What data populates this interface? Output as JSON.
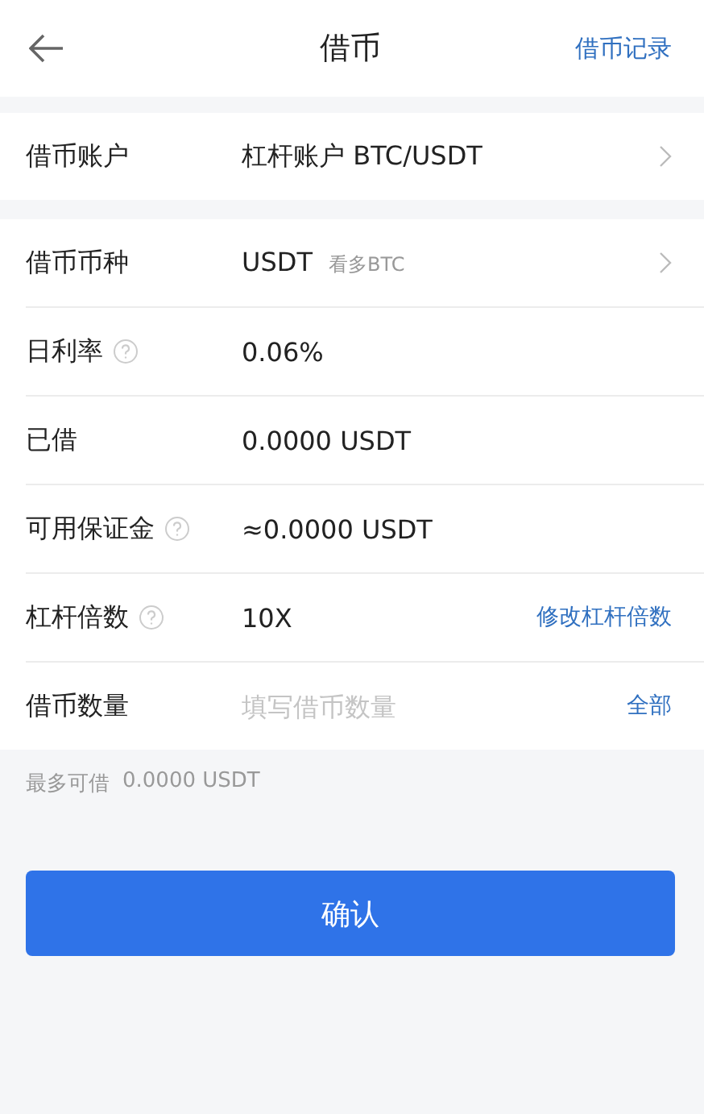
{
  "header": {
    "title": "借币",
    "action": "借币记录"
  },
  "account": {
    "kind": "select",
    "label": "借币账户",
    "value": "杠杆账户 BTC/USDT"
  },
  "rows": [
    {
      "kind": "select",
      "label": "借币币种",
      "help": false,
      "value": "USDT",
      "sub": "看多BTC"
    },
    {
      "kind": "info",
      "label": "日利率",
      "help": true,
      "value": "0.06%"
    },
    {
      "kind": "info",
      "label": "已借",
      "help": false,
      "value": "0.0000 USDT"
    },
    {
      "kind": "info",
      "label": "可用保证金",
      "help": true,
      "value": "≈0.0000 USDT"
    },
    {
      "kind": "action",
      "label": "杠杆倍数",
      "help": true,
      "value": "10X",
      "action": "修改杠杆倍数"
    },
    {
      "kind": "input",
      "label": "借币数量",
      "help": false,
      "placeholder": "填写借币数量",
      "action": "全部"
    }
  ],
  "max_note": {
    "label": "最多可借",
    "value": "0.0000 USDT"
  },
  "confirm": "确认"
}
